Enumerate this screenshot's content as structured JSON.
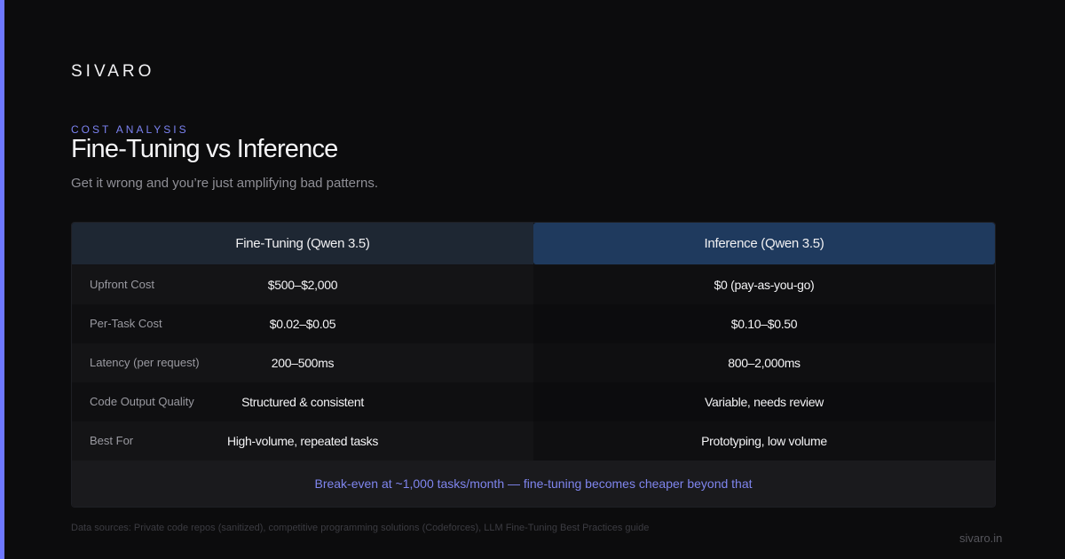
{
  "brand": "SIVARO",
  "eyebrow": "COST ANALYSIS",
  "title": "Fine-Tuning vs Inference",
  "subtitle": "Get it wrong and you’re just amplifying bad patterns.",
  "table": {
    "columns": [
      "Fine-Tuning (Qwen 3.5)",
      "Inference (Qwen 3.5)"
    ],
    "rows": [
      {
        "label": "Upfront Cost",
        "fine_tuning": "$500–$2,000",
        "inference": "$0 (pay-as-you-go)"
      },
      {
        "label": "Per-Task Cost",
        "fine_tuning": "$0.02–$0.05",
        "inference": "$0.10–$0.50"
      },
      {
        "label": "Latency (per request)",
        "fine_tuning": "200–500ms",
        "inference": "800–2,000ms"
      },
      {
        "label": "Code Output Quality",
        "fine_tuning": "Structured & consistent",
        "inference": "Variable, needs review"
      },
      {
        "label": "Best For",
        "fine_tuning": "High-volume, repeated tasks",
        "inference": "Prototyping, low volume"
      }
    ],
    "footer": "Break-even at ~1,000 tasks/month — fine-tuning becomes cheaper beyond that"
  },
  "sources": "Data sources: Private code repos (sanitized), competitive programming solutions (Codeforces), LLM Fine-Tuning Best Practices guide",
  "site": "sivaro.in",
  "colors": {
    "accent": "#6e78ff",
    "background": "#0c0c0d",
    "inference_header": "#1f3a5e",
    "fine_tuning_header": "#1e2733"
  }
}
